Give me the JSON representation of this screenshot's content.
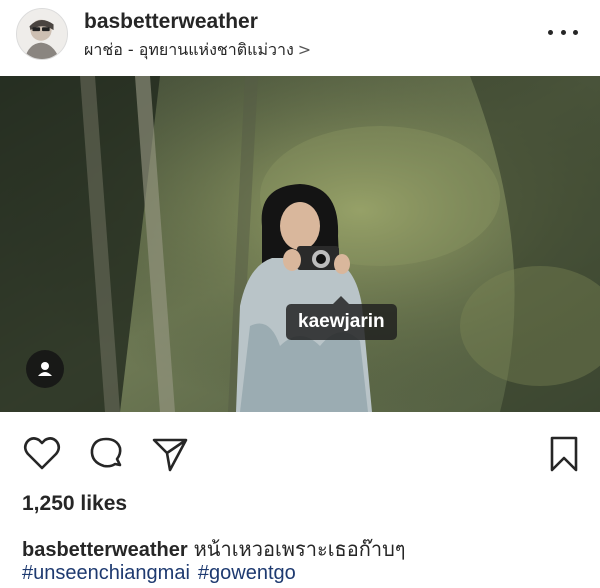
{
  "post": {
    "username": "basbetterweather",
    "location": "ผาช่อ - อุทยานแห่งชาติแม่วาง",
    "location_chevron": ">",
    "tag_label": "kaewjarin",
    "likes": "1,250 likes",
    "caption_user": "basbetterweather",
    "caption_text": "หน้าเหวอเพราะเธอก๊าบๆ",
    "hashtags": [
      "#unseenchiangmai",
      "#gowentgo"
    ]
  },
  "icons": {
    "like": "heart-icon",
    "comment": "comment-icon",
    "share": "send-icon",
    "save": "bookmark-icon",
    "more": "more-options-icon",
    "tag": "user-tag-icon"
  },
  "colors": {
    "text": "#262626",
    "hashtag": "#1e3a70",
    "tag_bubble": "#1e1e1e"
  }
}
